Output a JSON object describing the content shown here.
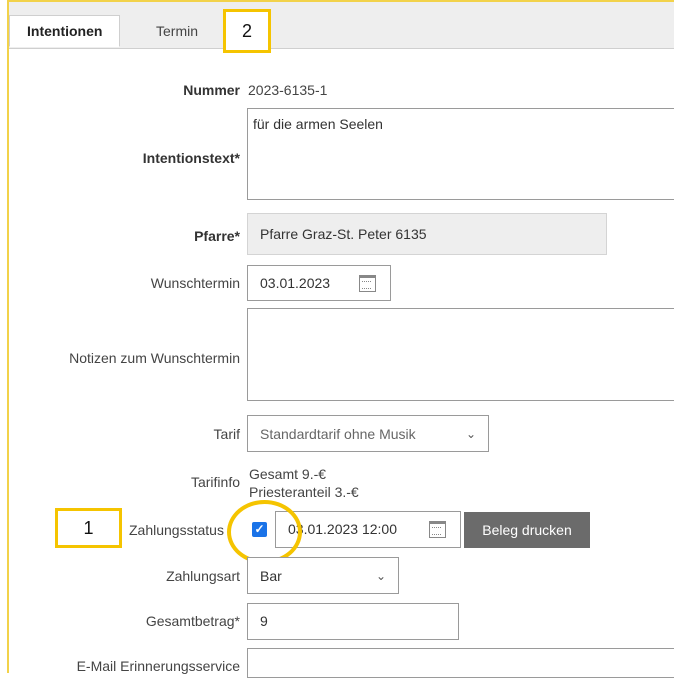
{
  "tabs": [
    {
      "label": "Intentionen"
    },
    {
      "label": "Termin"
    }
  ],
  "callouts": {
    "one": "1",
    "two": "2"
  },
  "form": {
    "nummer": {
      "label": "Nummer",
      "value": "2023-6135-1"
    },
    "intentionstext": {
      "label": "Intentionstext*",
      "value": "für die armen Seelen"
    },
    "pfarre": {
      "label": "Pfarre*",
      "value": "Pfarre Graz-St. Peter 6135"
    },
    "wunschtermin": {
      "label": "Wunschtermin",
      "value": "03.01.2023",
      "icon": "calendar-icon"
    },
    "notizen": {
      "label": "Notizen zum Wunschtermin",
      "value": ""
    },
    "tarif": {
      "label": "Tarif",
      "value": "Standardtarif ohne Musik"
    },
    "tarifinfo": {
      "label": "Tarifinfo",
      "line1": "Gesamt 9.-€",
      "line2": "Priesteranteil 3.-€"
    },
    "zahlungsstatus": {
      "label": "Zahlungsstatus",
      "checked": true,
      "datetime": "03.01.2023 12:00",
      "icon": "calendar-icon",
      "button": "Beleg drucken"
    },
    "zahlungsart": {
      "label": "Zahlungsart",
      "value": "Bar"
    },
    "gesamtbetrag": {
      "label": "Gesamtbetrag*",
      "value": "9"
    },
    "email": {
      "label": "E-Mail Erinnerungsservice",
      "value": ""
    }
  },
  "colors": {
    "highlight": "#f5c400",
    "button": "#6b6b6b",
    "checkbox": "#1a73e8"
  }
}
